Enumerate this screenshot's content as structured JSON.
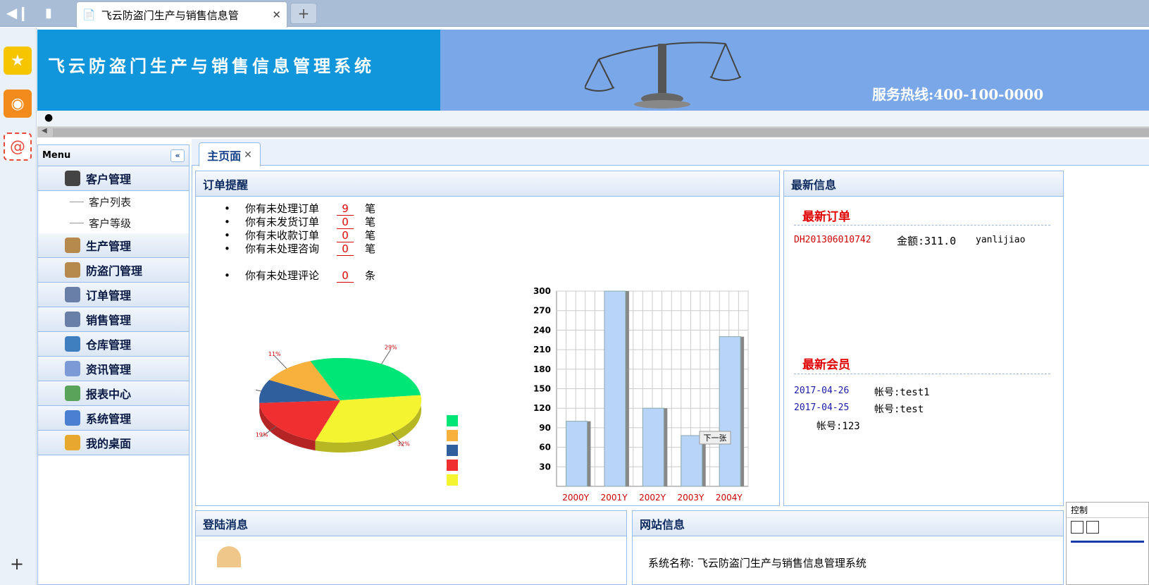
{
  "browser": {
    "tab_title": "飞云防盗门生产与销售信息管",
    "new_tab": "+",
    "close": "✕"
  },
  "banner": {
    "title": "飞云防盗门生产与销售信息管理系统",
    "hotline": "服务热线:400-100-0000"
  },
  "menu": {
    "title": "Menu",
    "collapse": "«",
    "groups": [
      {
        "label": "客户管理",
        "icon": "customer-icon",
        "color": "#444",
        "subs": [
          "客户列表",
          "客户等级"
        ]
      },
      {
        "label": "生产管理",
        "icon": "box-icon",
        "color": "#b58a4c"
      },
      {
        "label": "防盗门管理",
        "icon": "box-icon",
        "color": "#b58a4c"
      },
      {
        "label": "订单管理",
        "icon": "user-card-icon",
        "color": "#6a7fa8"
      },
      {
        "label": "销售管理",
        "icon": "user-card-icon",
        "color": "#6a7fa8"
      },
      {
        "label": "仓库管理",
        "icon": "warehouse-icon",
        "color": "#3f7fbf"
      },
      {
        "label": "资讯管理",
        "icon": "tag-icon",
        "color": "#7c9ad6"
      },
      {
        "label": "报表中心",
        "icon": "report-icon",
        "color": "#5aa35a"
      },
      {
        "label": "系统管理",
        "icon": "users-icon",
        "color": "#4a7fd1"
      },
      {
        "label": "我的桌面",
        "icon": "mail-icon",
        "color": "#e8a830"
      }
    ]
  },
  "main_tab": {
    "label": "主页面",
    "close": "✕"
  },
  "orders_panel": {
    "title": "订单提醒",
    "items": [
      {
        "label": "你有未处理订单",
        "value": "9",
        "unit": "笔"
      },
      {
        "label": "你有未发货订单",
        "value": "0",
        "unit": "笔"
      },
      {
        "label": "你有未收款订单",
        "value": "0",
        "unit": "笔"
      },
      {
        "label": "你有未处理咨询",
        "value": "0",
        "unit": "笔"
      }
    ],
    "comment": {
      "label": "你有未处理评论",
      "value": "0",
      "unit": "条"
    }
  },
  "chart_data": [
    {
      "type": "pie",
      "values": [
        29,
        32,
        19,
        9,
        11
      ],
      "labels": [
        "29%",
        "32%",
        "19%",
        "9%",
        "11%"
      ],
      "colors": [
        "#00e676",
        "#f4f431",
        "#f03030",
        "#2f5f9c",
        "#f8b13c"
      ],
      "legend_colors": [
        "#00e676",
        "#f8b13c",
        "#2f5f9c",
        "#f03030",
        "#f4f431"
      ]
    },
    {
      "type": "bar",
      "categories": [
        "2000Y",
        "2001Y",
        "2002Y",
        "2003Y",
        "2004Y"
      ],
      "values": [
        100,
        300,
        120,
        78,
        230
      ],
      "ylim": [
        0,
        300
      ],
      "yticks": [
        30,
        60,
        90,
        120,
        150,
        180,
        210,
        240,
        270,
        300
      ],
      "tooltip": "下一张",
      "color": "#b8d4f8"
    }
  ],
  "news_panel": {
    "title": "最新信息",
    "latest_orders": "最新订单",
    "order": {
      "id": "DH201306010742",
      "amount": "金额:311.0",
      "user": "yanlijiao"
    },
    "latest_members": "最新会员",
    "members": [
      {
        "date": "2017-04-26",
        "account": "帐号:test1"
      },
      {
        "date": "2017-04-25",
        "account": "帐号:test"
      },
      {
        "date": "",
        "account": "帐号:123"
      }
    ]
  },
  "login_panel": {
    "title": "登陆消息"
  },
  "site_panel": {
    "title": "网站信息",
    "name": "系统名称:  飞云防盗门生产与销售信息管理系统"
  },
  "control": {
    "title": "控制"
  }
}
